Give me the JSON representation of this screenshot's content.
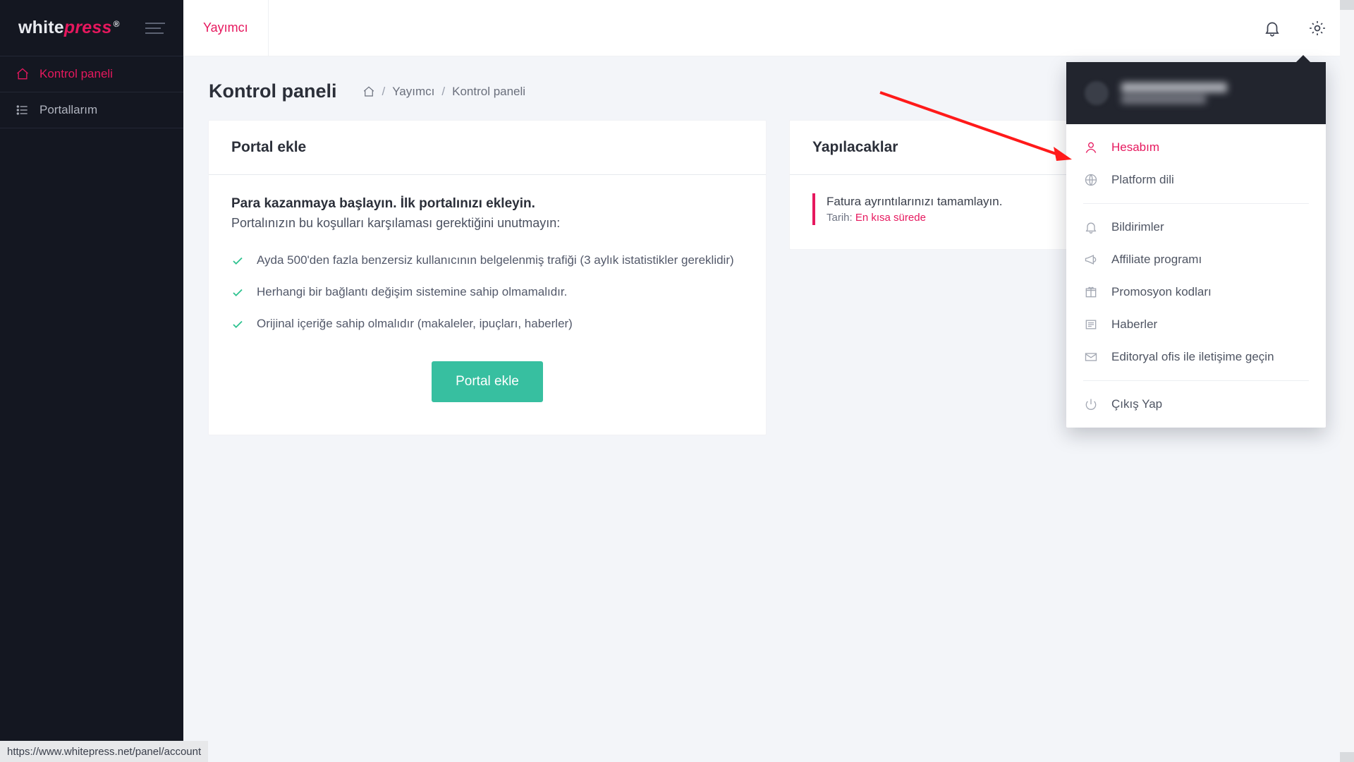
{
  "brand": {
    "part1": "white",
    "part2": "press",
    "reg": "®"
  },
  "sidebar": {
    "items": [
      {
        "label": "Kontrol paneli",
        "active": true
      },
      {
        "label": "Portallarım",
        "active": false
      }
    ]
  },
  "topbar": {
    "role_label": "Yayımcı"
  },
  "page": {
    "title": "Kontrol paneli",
    "breadcrumbs": {
      "b1": "Yayımcı",
      "b2": "Kontrol paneli"
    }
  },
  "add_portal_card": {
    "title": "Portal ekle",
    "subtitle": "Para kazanmaya başlayın. İlk portalınızı ekleyin.",
    "note": "Portalınızın bu koşulları karşılaması gerektiğini unutmayın:",
    "checks": [
      "Ayda 500'den fazla benzersiz kullanıcının belgelenmiş trafiği (3 aylık istatistikler gereklidir)",
      "Herhangi bir bağlantı değişim sistemine sahip olmamalıdır.",
      "Orijinal içeriğe sahip olmalıdır (makaleler, ipuçları, haberler)"
    ],
    "button": "Portal ekle"
  },
  "todo_card": {
    "title": "Yapılacaklar",
    "item_title": "Fatura ayrıntılarınızı tamamlayın.",
    "item_meta_label": "Tarih:",
    "item_due": "En kısa sürede"
  },
  "settings_menu": {
    "items": [
      {
        "label": "Hesabım",
        "active": true
      },
      {
        "label": "Platform dili",
        "active": false
      }
    ],
    "items2": [
      {
        "label": "Bildirimler"
      },
      {
        "label": "Affiliate programı"
      },
      {
        "label": "Promosyon kodları"
      },
      {
        "label": "Haberler"
      },
      {
        "label": "Editoryal ofis ile iletişime geçin"
      }
    ],
    "logout": "Çıkış Yap"
  },
  "statusbar": {
    "text": "https://www.whitepress.net/panel/account"
  }
}
